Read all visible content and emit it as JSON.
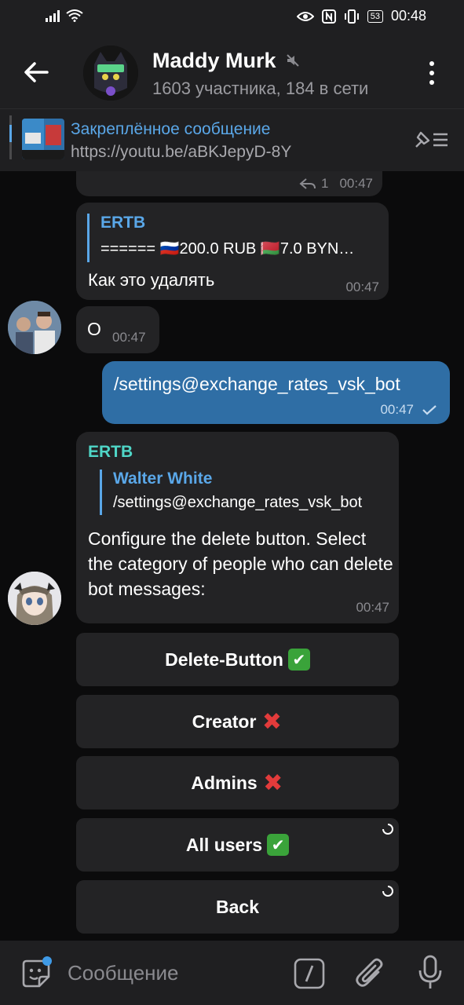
{
  "status_bar": {
    "battery": "53",
    "time": "00:48"
  },
  "header": {
    "title": "Maddy Murk",
    "subtitle": "1603 участника, 184 в сети"
  },
  "pinned": {
    "title": "Закреплённое сообщение",
    "url": "https://youtu.be/aBKJepyD-8Y"
  },
  "messages": [
    {
      "reply_count": "1",
      "time": "00:47"
    },
    {
      "quote_name": "ERTB",
      "quote_text": "====== 🇷🇺200.0 RUB  🇧🇾7.0 BYN…",
      "text": "Как это удалять",
      "time": "00:47"
    },
    {
      "text": "О",
      "time": "00:47"
    },
    {
      "text": "/settings@exchange_rates_vsk_bot",
      "time": "00:47"
    },
    {
      "sender": "ERTB",
      "quote_name": "Walter White",
      "quote_text": "/settings@exchange_rates_vsk_bot",
      "text": "Configure the delete button. Select the category of people who can delete bot messages:",
      "time": "00:47"
    }
  ],
  "keyboard": [
    {
      "label": "Delete-Button",
      "emoji": "✔"
    },
    {
      "label": "Creator",
      "emoji": "✖"
    },
    {
      "label": "Admins",
      "emoji": "✖"
    },
    {
      "label": "All users",
      "emoji": "✔"
    },
    {
      "label": "Back",
      "emoji": ""
    }
  ],
  "composer": {
    "placeholder": "Сообщение"
  },
  "colors": {
    "accent": "#5aa7e8",
    "outgoing_bubble": "#2f6ea5",
    "bot_name": "#4fd6c7",
    "check": "#3aa33a",
    "cross": "#e23b3b"
  }
}
